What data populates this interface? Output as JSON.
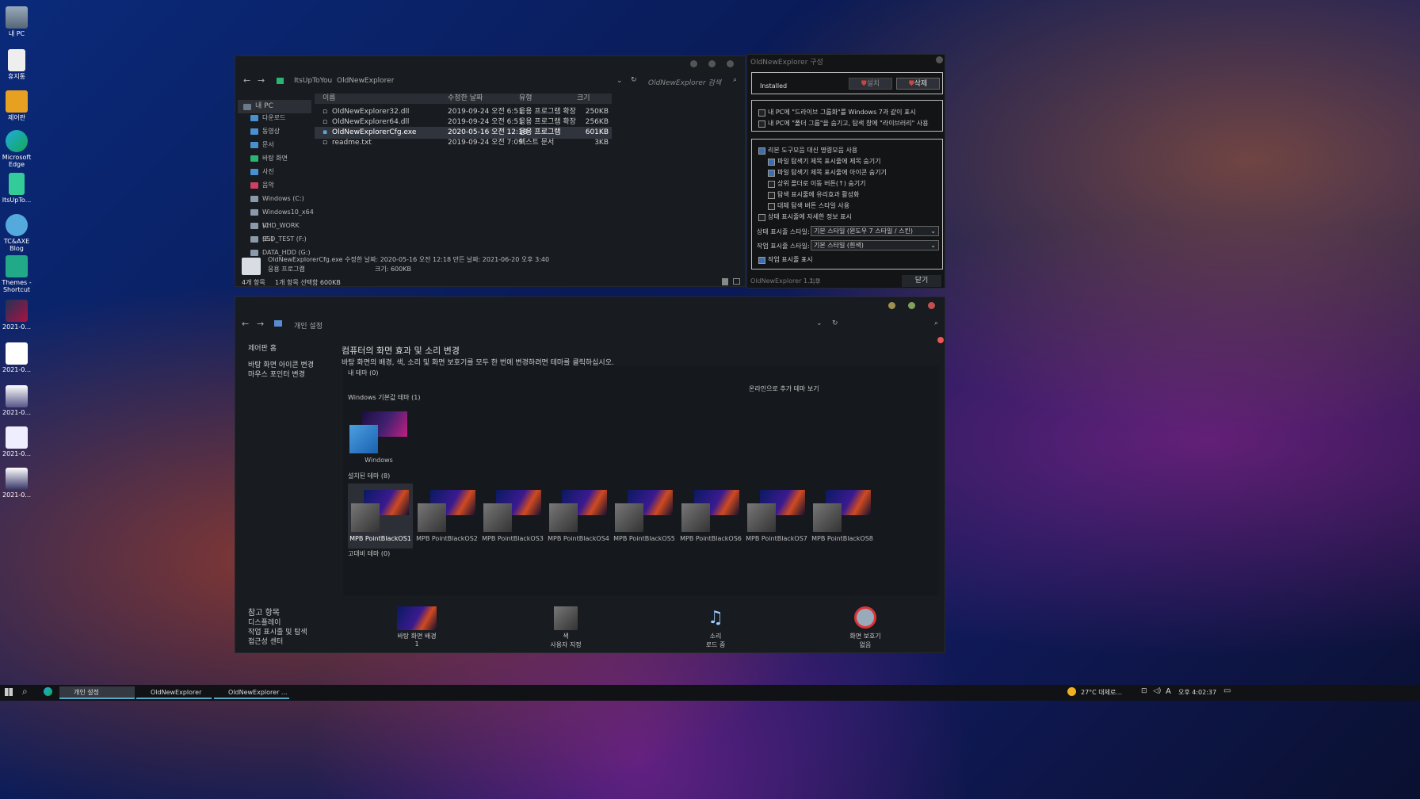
{
  "desktop": {
    "icons": [
      "내 PC",
      "휴지통",
      "제어판",
      "Microsoft Edge",
      "ItsUpTo...",
      "TC&AXE Blog",
      "Themes - Shortcut",
      "2021-0...",
      "2021-0...",
      "2021-0...",
      "2021-0...",
      "2021-0..."
    ]
  },
  "explorer": {
    "breadcrumb": [
      "ItsUpToYou",
      "OldNewExplorer"
    ],
    "search_placeholder": "OldNewExplorer 검색",
    "tree": [
      "내 PC",
      "다운로드",
      "동영상",
      "문서",
      "바탕 화면",
      "사진",
      "음악",
      "Windows (C:)",
      "Windows10_x64 (C",
      "VHD_WORK (E:)",
      "SSD_TEST (F:)",
      "DATA_HDD (G:)"
    ],
    "columns": [
      "이름",
      "수정한 날짜",
      "유형",
      "크기"
    ],
    "files": [
      [
        "OldNewExplorer32.dll",
        "2019-09-24 오전 6:51",
        "응용 프로그램 확장",
        "250KB"
      ],
      [
        "OldNewExplorer64.dll",
        "2019-09-24 오전 6:51",
        "응용 프로그램 확장",
        "256KB"
      ],
      [
        "OldNewExplorerCfg.exe",
        "2020-05-16 오전 12:18",
        "응용 프로그램",
        "601KB"
      ],
      [
        "readme.txt",
        "2019-09-24 오전 7:09",
        "텍스트 문서",
        "3KB"
      ]
    ],
    "details_line1": "OldNewExplorerCfg.exe 수정한 날짜: 2020-05-16 오전 12:18 만든 날짜: 2021-06-20 오후 3:40",
    "details_line2a": "응용 프로그램",
    "details_line2b": "크기: 600KB",
    "status_count": "4개 항목",
    "status_sel": "1개 항목 선택함 600KB"
  },
  "config": {
    "title": "OldNewExplorer 구성",
    "installed": "Installed",
    "install_btn": "설치",
    "uninstall_btn": "삭제",
    "opts1": [
      "내 PC에 \"드라이브 그룹화\"를 Windows 7과 같이 표시",
      "내 PC에 \"폴더 그룹\"을 숨기고, 탐색 창에 \"라이브러리\" 사용"
    ],
    "opts2": [
      "리본 도구모음 대신 명령모음 사용",
      "파일 탐색기 제목 표시줄에 제목 숨기기",
      "파일 탐색기 제목 표시줄에 아이콘 숨기기",
      "상위 폴더로 이동 버튼(↑) 숨기기",
      "탐색 표시줄에 유리효과 활성화",
      "대체 탐색 버튼 스타일 사용",
      "상태 표시줄에 자세한 정보 표시"
    ],
    "status_style_label": "상태 표시줄 스타일:",
    "status_style_value": "기본 스타일 (윈도우 7 스타일 / 스킨)",
    "cmd_style_label": "작업 표시줄 스타일:",
    "cmd_style_value": "기본 스타일 (흰색)",
    "show_cmd": "작업 표시줄 표시",
    "version": "OldNewExplorer 1.1.9",
    "donate": "기부",
    "close_btn": "닫기"
  },
  "personalize": {
    "breadcrumb": "개인 설정",
    "side_home": "제어판 홈",
    "side_links": [
      "바탕 화면 아이콘 변경",
      "마우스 포인터 변경"
    ],
    "title": "컴퓨터의 화면 효과 및 소리 변경",
    "desc": "바탕 화면의 배경, 색, 소리 및 화면 보호기를 모두 한 번에 변경하려면 테마를 클릭하십시오.",
    "my_themes": "내 테마 (0)",
    "online": "온라인으로 추가 테마 보기",
    "default_themes": "Windows 기본값 테마 (1)",
    "windows_theme": "Windows",
    "installed_themes": "설치된 테마 (8)",
    "themes": [
      "MPB PointBlackOS1",
      "MPB PointBlackOS2",
      "MPB PointBlackOS3",
      "MPB PointBlackOS4",
      "MPB PointBlackOS5",
      "MPB PointBlackOS6",
      "MPB PointBlackOS7",
      "MPB PointBlackOS8"
    ],
    "high_contrast": "고대비 테마 (0)",
    "see_also": "참고 항목",
    "see_also_links": [
      "디스플레이",
      "작업 표시줄 및 탐색",
      "접근성 센터"
    ],
    "bottom": [
      [
        "바탕 화면 배경",
        "1"
      ],
      [
        "색",
        "사용자 지정"
      ],
      [
        "소리",
        "로드 중"
      ],
      [
        "화면 보호기",
        "없음"
      ]
    ]
  },
  "taskbar": {
    "items": [
      "개인 설정",
      "OldNewExplorer",
      "OldNewExplorer ..."
    ],
    "weather": "27°C 대체로...",
    "ime": "A",
    "time": "오후 4:02:37"
  }
}
